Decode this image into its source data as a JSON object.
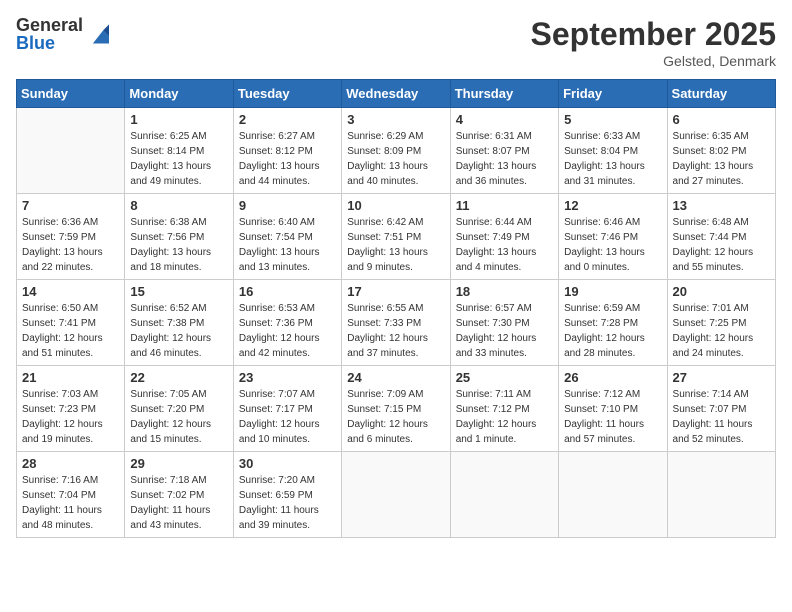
{
  "header": {
    "logo_general": "General",
    "logo_blue": "Blue",
    "month_title": "September 2025",
    "location": "Gelsted, Denmark"
  },
  "days_of_week": [
    "Sunday",
    "Monday",
    "Tuesday",
    "Wednesday",
    "Thursday",
    "Friday",
    "Saturday"
  ],
  "weeks": [
    [
      {
        "day": "",
        "info": ""
      },
      {
        "day": "1",
        "info": "Sunrise: 6:25 AM\nSunset: 8:14 PM\nDaylight: 13 hours\nand 49 minutes."
      },
      {
        "day": "2",
        "info": "Sunrise: 6:27 AM\nSunset: 8:12 PM\nDaylight: 13 hours\nand 44 minutes."
      },
      {
        "day": "3",
        "info": "Sunrise: 6:29 AM\nSunset: 8:09 PM\nDaylight: 13 hours\nand 40 minutes."
      },
      {
        "day": "4",
        "info": "Sunrise: 6:31 AM\nSunset: 8:07 PM\nDaylight: 13 hours\nand 36 minutes."
      },
      {
        "day": "5",
        "info": "Sunrise: 6:33 AM\nSunset: 8:04 PM\nDaylight: 13 hours\nand 31 minutes."
      },
      {
        "day": "6",
        "info": "Sunrise: 6:35 AM\nSunset: 8:02 PM\nDaylight: 13 hours\nand 27 minutes."
      }
    ],
    [
      {
        "day": "7",
        "info": "Sunrise: 6:36 AM\nSunset: 7:59 PM\nDaylight: 13 hours\nand 22 minutes."
      },
      {
        "day": "8",
        "info": "Sunrise: 6:38 AM\nSunset: 7:56 PM\nDaylight: 13 hours\nand 18 minutes."
      },
      {
        "day": "9",
        "info": "Sunrise: 6:40 AM\nSunset: 7:54 PM\nDaylight: 13 hours\nand 13 minutes."
      },
      {
        "day": "10",
        "info": "Sunrise: 6:42 AM\nSunset: 7:51 PM\nDaylight: 13 hours\nand 9 minutes."
      },
      {
        "day": "11",
        "info": "Sunrise: 6:44 AM\nSunset: 7:49 PM\nDaylight: 13 hours\nand 4 minutes."
      },
      {
        "day": "12",
        "info": "Sunrise: 6:46 AM\nSunset: 7:46 PM\nDaylight: 13 hours\nand 0 minutes."
      },
      {
        "day": "13",
        "info": "Sunrise: 6:48 AM\nSunset: 7:44 PM\nDaylight: 12 hours\nand 55 minutes."
      }
    ],
    [
      {
        "day": "14",
        "info": "Sunrise: 6:50 AM\nSunset: 7:41 PM\nDaylight: 12 hours\nand 51 minutes."
      },
      {
        "day": "15",
        "info": "Sunrise: 6:52 AM\nSunset: 7:38 PM\nDaylight: 12 hours\nand 46 minutes."
      },
      {
        "day": "16",
        "info": "Sunrise: 6:53 AM\nSunset: 7:36 PM\nDaylight: 12 hours\nand 42 minutes."
      },
      {
        "day": "17",
        "info": "Sunrise: 6:55 AM\nSunset: 7:33 PM\nDaylight: 12 hours\nand 37 minutes."
      },
      {
        "day": "18",
        "info": "Sunrise: 6:57 AM\nSunset: 7:30 PM\nDaylight: 12 hours\nand 33 minutes."
      },
      {
        "day": "19",
        "info": "Sunrise: 6:59 AM\nSunset: 7:28 PM\nDaylight: 12 hours\nand 28 minutes."
      },
      {
        "day": "20",
        "info": "Sunrise: 7:01 AM\nSunset: 7:25 PM\nDaylight: 12 hours\nand 24 minutes."
      }
    ],
    [
      {
        "day": "21",
        "info": "Sunrise: 7:03 AM\nSunset: 7:23 PM\nDaylight: 12 hours\nand 19 minutes."
      },
      {
        "day": "22",
        "info": "Sunrise: 7:05 AM\nSunset: 7:20 PM\nDaylight: 12 hours\nand 15 minutes."
      },
      {
        "day": "23",
        "info": "Sunrise: 7:07 AM\nSunset: 7:17 PM\nDaylight: 12 hours\nand 10 minutes."
      },
      {
        "day": "24",
        "info": "Sunrise: 7:09 AM\nSunset: 7:15 PM\nDaylight: 12 hours\nand 6 minutes."
      },
      {
        "day": "25",
        "info": "Sunrise: 7:11 AM\nSunset: 7:12 PM\nDaylight: 12 hours\nand 1 minute."
      },
      {
        "day": "26",
        "info": "Sunrise: 7:12 AM\nSunset: 7:10 PM\nDaylight: 11 hours\nand 57 minutes."
      },
      {
        "day": "27",
        "info": "Sunrise: 7:14 AM\nSunset: 7:07 PM\nDaylight: 11 hours\nand 52 minutes."
      }
    ],
    [
      {
        "day": "28",
        "info": "Sunrise: 7:16 AM\nSunset: 7:04 PM\nDaylight: 11 hours\nand 48 minutes."
      },
      {
        "day": "29",
        "info": "Sunrise: 7:18 AM\nSunset: 7:02 PM\nDaylight: 11 hours\nand 43 minutes."
      },
      {
        "day": "30",
        "info": "Sunrise: 7:20 AM\nSunset: 6:59 PM\nDaylight: 11 hours\nand 39 minutes."
      },
      {
        "day": "",
        "info": ""
      },
      {
        "day": "",
        "info": ""
      },
      {
        "day": "",
        "info": ""
      },
      {
        "day": "",
        "info": ""
      }
    ]
  ]
}
